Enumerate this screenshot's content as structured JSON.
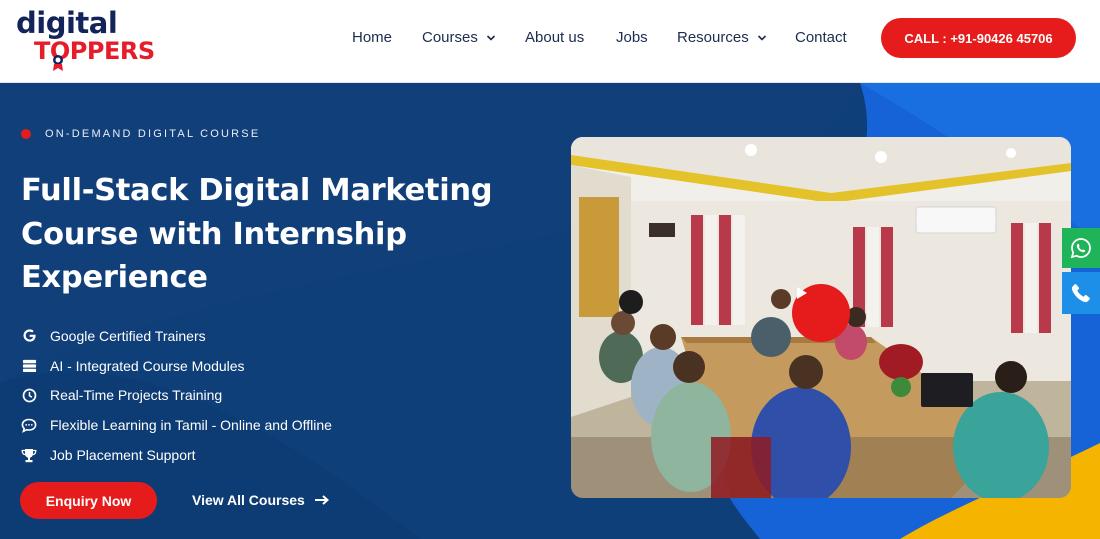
{
  "brand": {
    "line1": "digital",
    "line2": "TOPPERS"
  },
  "nav": {
    "home": "Home",
    "courses": "Courses",
    "about": "About us",
    "jobs": "Jobs",
    "resources": "Resources",
    "contact": "Contact"
  },
  "call_button": "CALL : +91-90426 45706",
  "hero": {
    "tag": "ON-DEMAND DIGITAL COURSE",
    "title": "Full-Stack Digital Marketing Course with Internship Experience",
    "features": [
      {
        "icon": "google-icon",
        "text": "Google Certified Trainers"
      },
      {
        "icon": "server-icon",
        "text": "AI - Integrated Course Modules"
      },
      {
        "icon": "clock-icon",
        "text": "Real-Time Projects Training"
      },
      {
        "icon": "chat-icon",
        "text": "Flexible Learning in Tamil - Online and Offline"
      },
      {
        "icon": "trophy-icon",
        "text": "Job Placement Support"
      }
    ],
    "enquiry_button": "Enquiry Now",
    "view_all": "View All Courses"
  },
  "colors": {
    "primary_red": "#e61c1c",
    "navy": "#12245a",
    "hero_blue": "#0f3f78",
    "accent_blue": "#1563d6",
    "accent_yellow": "#f5b400",
    "whatsapp_green": "#1fb35a",
    "call_blue": "#1d8fe8"
  }
}
